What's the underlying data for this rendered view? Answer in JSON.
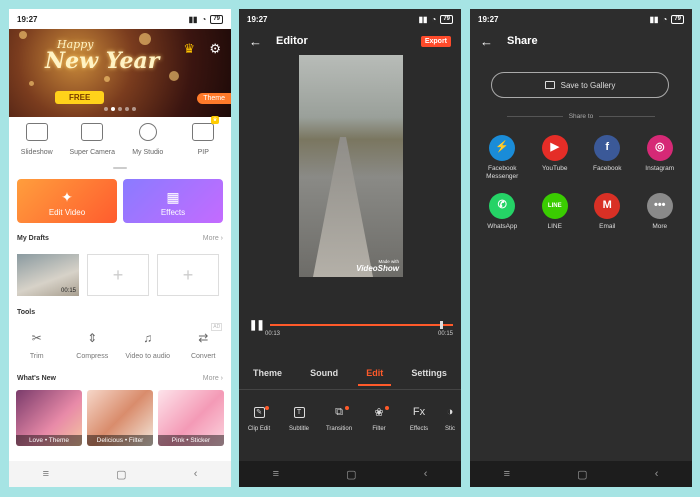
{
  "status": {
    "time": "19:27",
    "battery": "79"
  },
  "home": {
    "banner": {
      "title_line1": "Happy",
      "title_line2": "New Year",
      "free_label": "FREE",
      "theme_tag": "Theme"
    },
    "features": [
      {
        "label": "Slideshow",
        "icon": "slideshow-icon"
      },
      {
        "label": "Super Camera",
        "icon": "camera-icon"
      },
      {
        "label": "My Studio",
        "icon": "studio-icon"
      },
      {
        "label": "PIP",
        "icon": "pip-icon"
      }
    ],
    "edit_video_label": "Edit Video",
    "effects_label": "Effects",
    "drafts_header": "My Drafts",
    "more_label": "More",
    "draft_duration": "00:15",
    "tools_header": "Tools",
    "tools": [
      {
        "label": "Trim",
        "icon": "scissors-icon"
      },
      {
        "label": "Compress",
        "icon": "compress-icon"
      },
      {
        "label": "Video to audio",
        "icon": "music-icon"
      },
      {
        "label": "Convert",
        "icon": "convert-icon"
      }
    ],
    "ad_tag": "AD",
    "whats_new_header": "What's New",
    "whats_new": [
      {
        "label": "Love • Theme"
      },
      {
        "label": "Delicious • Filter"
      },
      {
        "label": "Pink • Sticker"
      }
    ]
  },
  "editor": {
    "title": "Editor",
    "export_label": "Export",
    "watermark_line1": "Made with",
    "watermark_line2": "VideoShow",
    "time_current": "00:13",
    "time_total": "00:15",
    "tabs": [
      "Theme",
      "Sound",
      "Edit",
      "Settings"
    ],
    "active_tab": "Edit",
    "tools": [
      {
        "label": "Clip Edit",
        "icon": "clip-edit-icon",
        "dot": true
      },
      {
        "label": "Subtitle",
        "icon": "subtitle-icon",
        "dot": false
      },
      {
        "label": "Transition",
        "icon": "transition-icon",
        "dot": true
      },
      {
        "label": "Filter",
        "icon": "filter-icon",
        "dot": true
      },
      {
        "label": "Effects",
        "icon": "fx-icon",
        "dot": false
      },
      {
        "label": "Stic",
        "icon": "sticker-icon",
        "dot": false
      }
    ]
  },
  "share": {
    "title": "Share",
    "save_label": "Save to Gallery",
    "share_to_label": "Share to",
    "apps": [
      {
        "label": "Facebook Messenger",
        "icon": "messenger-icon",
        "color": "#1a8cd8",
        "glyph": "⚡"
      },
      {
        "label": "YouTube",
        "icon": "youtube-icon",
        "color": "#e52d27",
        "glyph": "▶"
      },
      {
        "label": "Facebook",
        "icon": "facebook-icon",
        "color": "#3b5998",
        "glyph": "f"
      },
      {
        "label": "Instagram",
        "icon": "instagram-icon",
        "color": "#d62976",
        "glyph": "◎"
      },
      {
        "label": "WhatsApp",
        "icon": "whatsapp-icon",
        "color": "#25d366",
        "glyph": "✆"
      },
      {
        "label": "LINE",
        "icon": "line-icon",
        "color": "#3acc01",
        "glyph": "LINE"
      },
      {
        "label": "Email",
        "icon": "email-icon",
        "color": "#d93025",
        "glyph": "M"
      },
      {
        "label": "More",
        "icon": "more-icon",
        "color": "#8a8a8a",
        "glyph": "•••"
      }
    ]
  },
  "nav": {
    "menu": "≡",
    "home": "▢",
    "back": "‹"
  }
}
